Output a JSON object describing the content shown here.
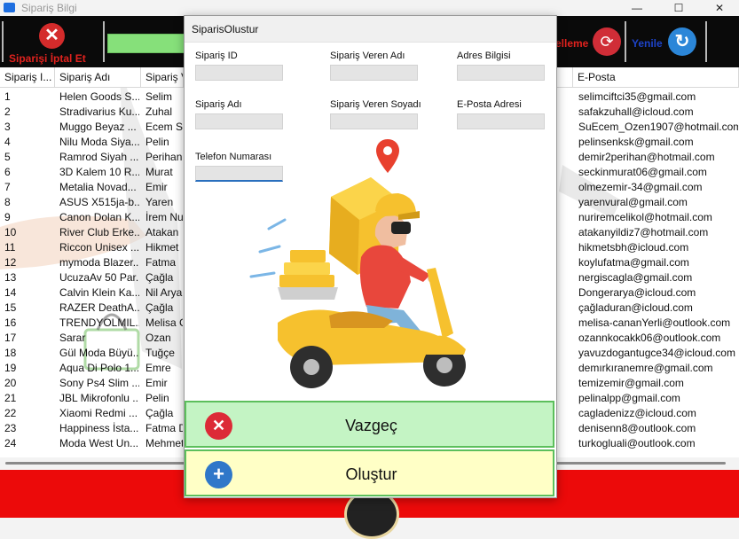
{
  "window": {
    "title": "Sipariş Bilgi",
    "minimize": "—",
    "maximize": "☐",
    "close": "✕"
  },
  "toolbar": {
    "cancel_order_label": "Siparişi İptal Et",
    "update_label": "elleme",
    "refresh_label": "Yenile"
  },
  "grid": {
    "columns": [
      "Sipariş I...",
      "Sipariş Adı",
      "Sipariş V...",
      "E-Posta"
    ],
    "rows": [
      {
        "id": "1",
        "name": "Helen Goods S...",
        "owner": "Selim",
        "email": "selimciftci35@gmail.com"
      },
      {
        "id": "2",
        "name": "Stradivarius Ku...",
        "owner": "Zuhal",
        "email": "safakzuhall@icloud.com"
      },
      {
        "id": "3",
        "name": "Muggo Beyaz ...",
        "owner": "Ecem Su",
        "email": "SuEcem_Ozen1907@hotmail.com"
      },
      {
        "id": "4",
        "name": "Nilu Moda Siya...",
        "owner": "Pelin",
        "email": "pelinsenksk@gmail.com"
      },
      {
        "id": "5",
        "name": "Ramrod Siyah ...",
        "owner": "Perihan",
        "email": "demir2perihan@hotmail.com"
      },
      {
        "id": "6",
        "name": "3D Kalem 10 R...",
        "owner": "Murat",
        "email": "seckinmurat06@gmail.com"
      },
      {
        "id": "7",
        "name": "Metalia Novad...",
        "owner": "Emir",
        "email": "olmezemir-34@gmail.com"
      },
      {
        "id": "8",
        "name": "ASUS X515ja-b...",
        "owner": "Yaren",
        "email": "yarenvural@gmail.com"
      },
      {
        "id": "9",
        "name": "Canon Dolan K...",
        "owner": "İrem Nu",
        "email": "nuriremcelikol@hotmail.com"
      },
      {
        "id": "10",
        "name": "River Club Erke...",
        "owner": "Atakan",
        "email": "atakanyildiz7@hotmail.com"
      },
      {
        "id": "11",
        "name": "Riccon Unisex ...",
        "owner": "Hikmet",
        "email": "hikmetsbh@icloud.com"
      },
      {
        "id": "12",
        "name": "mymoda Blazer...",
        "owner": "Fatma",
        "email": "koylufatma@gmail.com"
      },
      {
        "id": "13",
        "name": "UcuzaAv 50 Par...",
        "owner": "Çağla",
        "email": "nergiscagla@gmail.com"
      },
      {
        "id": "14",
        "name": "Calvin Klein Ka...",
        "owner": "Nil Arya",
        "email": "Dongerarya@icloud.com"
      },
      {
        "id": "15",
        "name": "RAZER DeathA...",
        "owner": "Çağla",
        "email": "çağladuran@icloud.com"
      },
      {
        "id": "16",
        "name": "TRENDYOLMIL...",
        "owner": "Melisa C",
        "email": "melisa-cananYerli@outlook.com"
      },
      {
        "id": "17",
        "name": "Sarar",
        "owner": "Ozan",
        "email": "ozannkocakk06@outlook.com"
      },
      {
        "id": "18",
        "name": "Gül Moda Büyü...",
        "owner": "Tuğçe",
        "email": "yavuzdogantugce34@icloud.com"
      },
      {
        "id": "19",
        "name": "Aqua Di Polo 1...",
        "owner": "Emre",
        "email": "demırkıranemre@gmail.com"
      },
      {
        "id": "20",
        "name": "Sony Ps4 Slim ...",
        "owner": "Emir",
        "email": "temizemir@gmail.com"
      },
      {
        "id": "21",
        "name": "JBL Mikrofonlu ...",
        "owner": "Pelin",
        "email": "pelinalpp@gmail.com"
      },
      {
        "id": "22",
        "name": "Xiaomi Redmi ...",
        "owner": "Çağla",
        "email": "cagladenizz@icloud.com"
      },
      {
        "id": "23",
        "name": "Happiness İsta...",
        "owner": "Fatma D",
        "email": "denisenn8@outlook.com"
      },
      {
        "id": "24",
        "name": "Moda West Un...",
        "owner": "Mehmet",
        "email": "turkogluali@outlook.com"
      }
    ]
  },
  "dialog": {
    "title": "SiparisOlustur",
    "labels": {
      "order_id": "Sipariş ID",
      "customer_name": "Sipariş Veren Adı",
      "address": "Adres Bilgisi",
      "order_name": "Sipariş Adı",
      "customer_surname": "Sipariş Veren Soyadı",
      "email": "E-Posta Adresi",
      "phone": "Telefon Numarası"
    },
    "values": {
      "order_id": "",
      "customer_name": "",
      "address": "",
      "order_name": "",
      "customer_surname": "",
      "email": "",
      "phone": ""
    },
    "cancel_label": "Vazgeç",
    "create_label": "Oluştur"
  },
  "colors": {
    "accent_red": "#ec0a0a",
    "cancel_bg": "#c4f4c4",
    "create_bg": "#ffffc6",
    "border_green": "#5cbf5c"
  }
}
